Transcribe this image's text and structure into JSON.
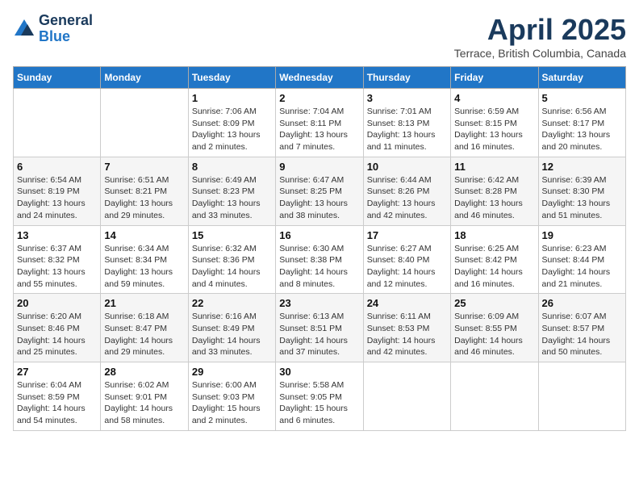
{
  "header": {
    "logo_line1": "General",
    "logo_line2": "Blue",
    "month_year": "April 2025",
    "location": "Terrace, British Columbia, Canada"
  },
  "weekdays": [
    "Sunday",
    "Monday",
    "Tuesday",
    "Wednesday",
    "Thursday",
    "Friday",
    "Saturday"
  ],
  "weeks": [
    [
      {
        "day": "",
        "info": ""
      },
      {
        "day": "",
        "info": ""
      },
      {
        "day": "1",
        "info": "Sunrise: 7:06 AM\nSunset: 8:09 PM\nDaylight: 13 hours\nand 2 minutes."
      },
      {
        "day": "2",
        "info": "Sunrise: 7:04 AM\nSunset: 8:11 PM\nDaylight: 13 hours\nand 7 minutes."
      },
      {
        "day": "3",
        "info": "Sunrise: 7:01 AM\nSunset: 8:13 PM\nDaylight: 13 hours\nand 11 minutes."
      },
      {
        "day": "4",
        "info": "Sunrise: 6:59 AM\nSunset: 8:15 PM\nDaylight: 13 hours\nand 16 minutes."
      },
      {
        "day": "5",
        "info": "Sunrise: 6:56 AM\nSunset: 8:17 PM\nDaylight: 13 hours\nand 20 minutes."
      }
    ],
    [
      {
        "day": "6",
        "info": "Sunrise: 6:54 AM\nSunset: 8:19 PM\nDaylight: 13 hours\nand 24 minutes."
      },
      {
        "day": "7",
        "info": "Sunrise: 6:51 AM\nSunset: 8:21 PM\nDaylight: 13 hours\nand 29 minutes."
      },
      {
        "day": "8",
        "info": "Sunrise: 6:49 AM\nSunset: 8:23 PM\nDaylight: 13 hours\nand 33 minutes."
      },
      {
        "day": "9",
        "info": "Sunrise: 6:47 AM\nSunset: 8:25 PM\nDaylight: 13 hours\nand 38 minutes."
      },
      {
        "day": "10",
        "info": "Sunrise: 6:44 AM\nSunset: 8:26 PM\nDaylight: 13 hours\nand 42 minutes."
      },
      {
        "day": "11",
        "info": "Sunrise: 6:42 AM\nSunset: 8:28 PM\nDaylight: 13 hours\nand 46 minutes."
      },
      {
        "day": "12",
        "info": "Sunrise: 6:39 AM\nSunset: 8:30 PM\nDaylight: 13 hours\nand 51 minutes."
      }
    ],
    [
      {
        "day": "13",
        "info": "Sunrise: 6:37 AM\nSunset: 8:32 PM\nDaylight: 13 hours\nand 55 minutes."
      },
      {
        "day": "14",
        "info": "Sunrise: 6:34 AM\nSunset: 8:34 PM\nDaylight: 13 hours\nand 59 minutes."
      },
      {
        "day": "15",
        "info": "Sunrise: 6:32 AM\nSunset: 8:36 PM\nDaylight: 14 hours\nand 4 minutes."
      },
      {
        "day": "16",
        "info": "Sunrise: 6:30 AM\nSunset: 8:38 PM\nDaylight: 14 hours\nand 8 minutes."
      },
      {
        "day": "17",
        "info": "Sunrise: 6:27 AM\nSunset: 8:40 PM\nDaylight: 14 hours\nand 12 minutes."
      },
      {
        "day": "18",
        "info": "Sunrise: 6:25 AM\nSunset: 8:42 PM\nDaylight: 14 hours\nand 16 minutes."
      },
      {
        "day": "19",
        "info": "Sunrise: 6:23 AM\nSunset: 8:44 PM\nDaylight: 14 hours\nand 21 minutes."
      }
    ],
    [
      {
        "day": "20",
        "info": "Sunrise: 6:20 AM\nSunset: 8:46 PM\nDaylight: 14 hours\nand 25 minutes."
      },
      {
        "day": "21",
        "info": "Sunrise: 6:18 AM\nSunset: 8:47 PM\nDaylight: 14 hours\nand 29 minutes."
      },
      {
        "day": "22",
        "info": "Sunrise: 6:16 AM\nSunset: 8:49 PM\nDaylight: 14 hours\nand 33 minutes."
      },
      {
        "day": "23",
        "info": "Sunrise: 6:13 AM\nSunset: 8:51 PM\nDaylight: 14 hours\nand 37 minutes."
      },
      {
        "day": "24",
        "info": "Sunrise: 6:11 AM\nSunset: 8:53 PM\nDaylight: 14 hours\nand 42 minutes."
      },
      {
        "day": "25",
        "info": "Sunrise: 6:09 AM\nSunset: 8:55 PM\nDaylight: 14 hours\nand 46 minutes."
      },
      {
        "day": "26",
        "info": "Sunrise: 6:07 AM\nSunset: 8:57 PM\nDaylight: 14 hours\nand 50 minutes."
      }
    ],
    [
      {
        "day": "27",
        "info": "Sunrise: 6:04 AM\nSunset: 8:59 PM\nDaylight: 14 hours\nand 54 minutes."
      },
      {
        "day": "28",
        "info": "Sunrise: 6:02 AM\nSunset: 9:01 PM\nDaylight: 14 hours\nand 58 minutes."
      },
      {
        "day": "29",
        "info": "Sunrise: 6:00 AM\nSunset: 9:03 PM\nDaylight: 15 hours\nand 2 minutes."
      },
      {
        "day": "30",
        "info": "Sunrise: 5:58 AM\nSunset: 9:05 PM\nDaylight: 15 hours\nand 6 minutes."
      },
      {
        "day": "",
        "info": ""
      },
      {
        "day": "",
        "info": ""
      },
      {
        "day": "",
        "info": ""
      }
    ]
  ]
}
